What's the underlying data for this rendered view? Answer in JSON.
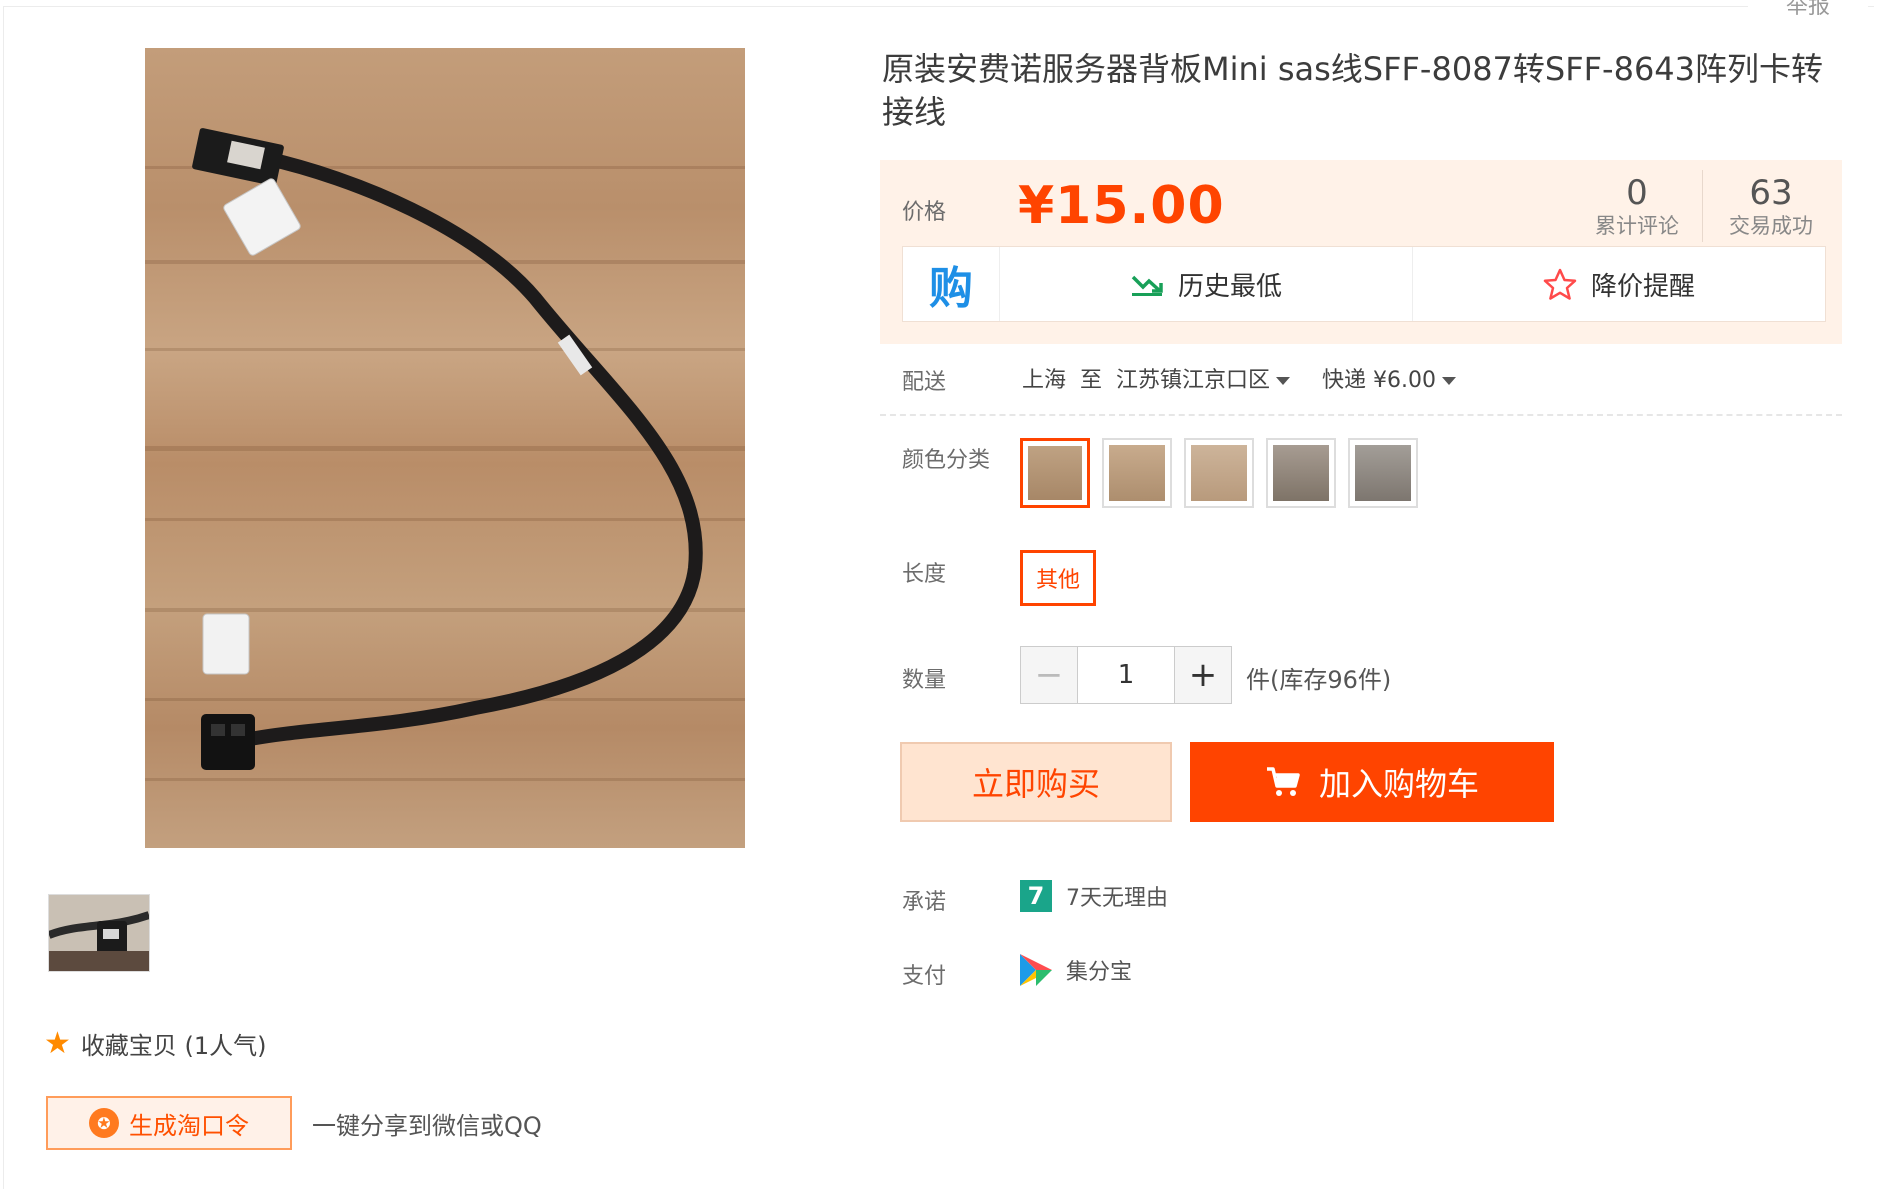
{
  "report": {
    "label": "举报"
  },
  "product": {
    "title": "原装安费诺服务器背板Mini sas线SFF-8087转SFF-8643阵列卡转接线"
  },
  "price_box": {
    "price_label": "价格",
    "price": "¥15.00",
    "stats": [
      {
        "value": "0",
        "label": "累计评论"
      },
      {
        "value": "63",
        "label": "交易成功"
      }
    ],
    "tools": {
      "buy_icon": "购",
      "history_lowest": "历史最低",
      "price_alert": "降价提醒"
    }
  },
  "shipping": {
    "label": "配送",
    "from": "上海",
    "to_word": "至",
    "destination": "江苏镇江京口区",
    "method": "快递 ¥6.00"
  },
  "color": {
    "label": "颜色分类",
    "selected_index": 0,
    "count": 5
  },
  "length": {
    "label": "长度",
    "option": "其他"
  },
  "quantity": {
    "label": "数量",
    "value": "1",
    "minus": "−",
    "plus": "+",
    "stock": "件(库存96件)"
  },
  "actions": {
    "buy_now": "立即购买",
    "add_to_cart": "加入购物车"
  },
  "promise": {
    "label": "承诺",
    "icon_text": "7",
    "text": "7天无理由"
  },
  "payment": {
    "label": "支付",
    "text": "集分宝"
  },
  "left": {
    "favorite": "收藏宝贝 (1人气)",
    "generate": "生成淘口令",
    "share": "一键分享到微信或QQ"
  },
  "colors": {
    "accent": "#ff4400",
    "price_bg": "#fff2e8"
  }
}
